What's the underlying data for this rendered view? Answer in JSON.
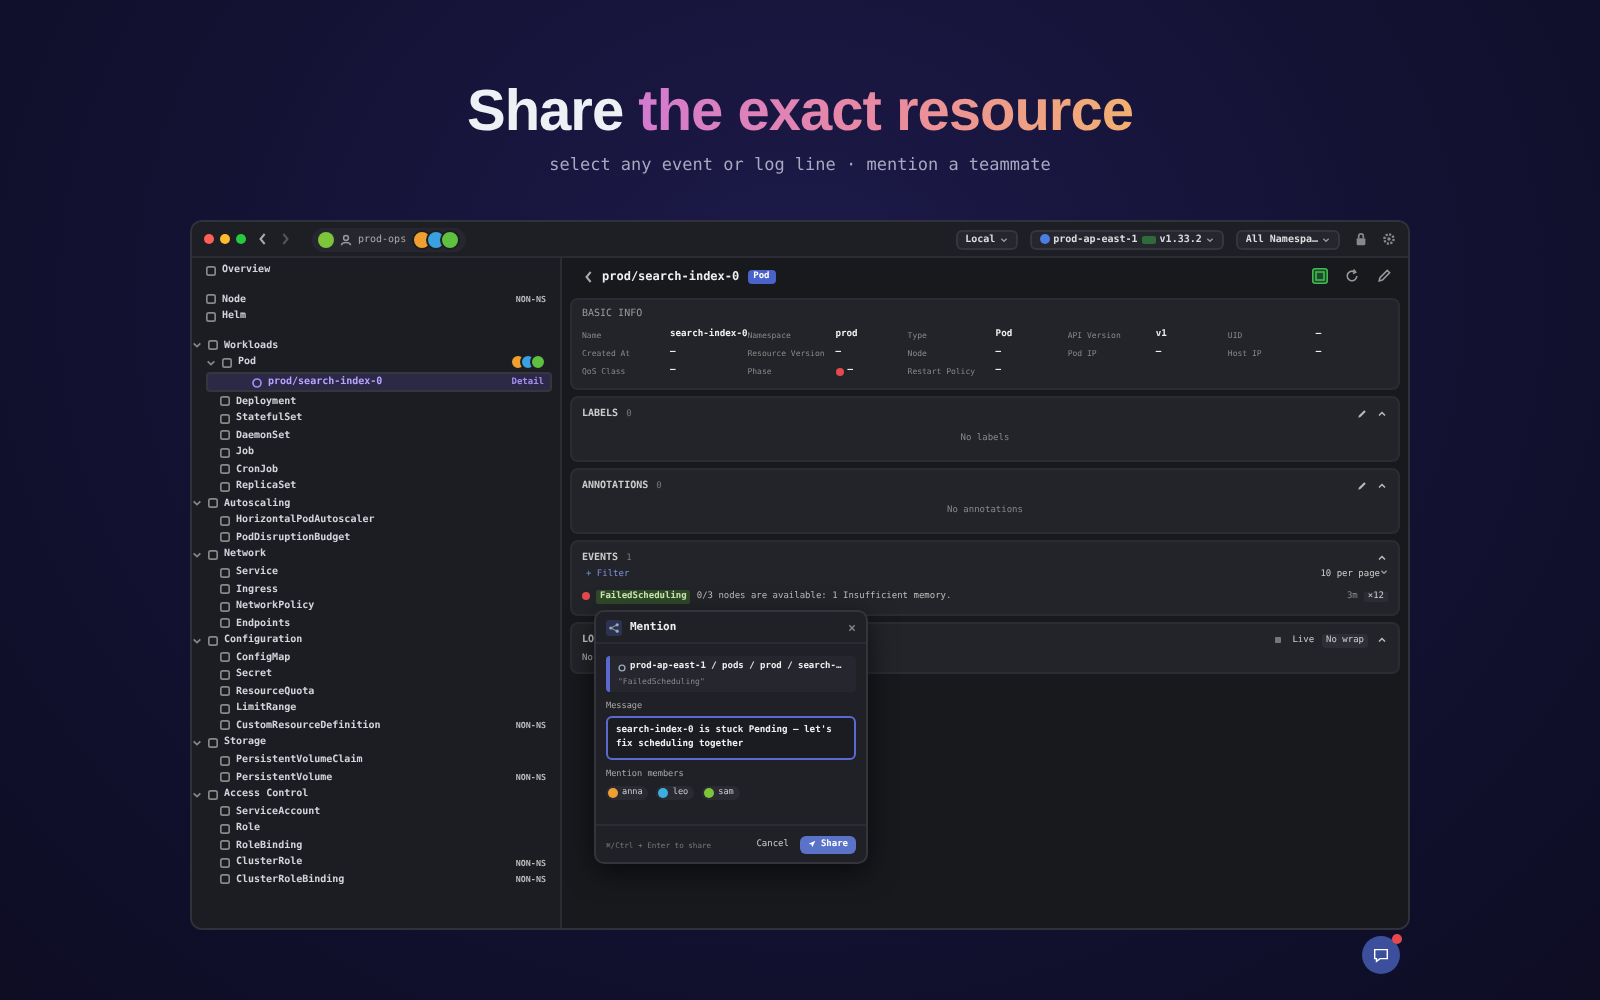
{
  "hero": {
    "title_plain": "Share",
    "title_gradient": "the exact resource",
    "subtitle": "select any event or log line · mention a teammate"
  },
  "topbar": {
    "workspace": "prod-ops",
    "avatars": [
      {
        "color": "#f0a030"
      },
      {
        "color": "#3aa0e0"
      },
      {
        "color": "#60c040"
      }
    ],
    "cluster": "Local",
    "context": "prod-ap-east-1",
    "version": "v1.33.2",
    "namespace": "All Namespa…"
  },
  "sidebar": {
    "items": [
      {
        "label": "Overview",
        "selected": false
      },
      {
        "label": "Node",
        "badge": "NON-NS",
        "selected": false
      },
      {
        "label": "Helm",
        "selected": false
      },
      {
        "label": "Workloads",
        "expanded": true,
        "selected": false,
        "children": [
          {
            "label": "Pod",
            "expanded": true,
            "selected": false,
            "avatars": [
              {
                "color": "#f0a030"
              },
              {
                "color": "#3aa0e0"
              },
              {
                "color": "#60c040"
              }
            ],
            "children": [
              {
                "label": "prod/search-index-0",
                "note": "Detail",
                "selected": true
              }
            ]
          },
          {
            "label": "Deployment",
            "selected": false
          },
          {
            "label": "StatefulSet",
            "selected": false
          },
          {
            "label": "DaemonSet",
            "selected": false
          },
          {
            "label": "Job",
            "selected": false
          },
          {
            "label": "CronJob",
            "selected": false
          },
          {
            "label": "ReplicaSet",
            "selected": false
          }
        ]
      },
      {
        "label": "Autoscaling",
        "expanded": true,
        "selected": false,
        "children": [
          {
            "label": "HorizontalPodAutoscaler",
            "selected": false
          },
          {
            "label": "PodDisruptionBudget",
            "selected": false
          }
        ]
      },
      {
        "label": "Network",
        "expanded": true,
        "selected": false,
        "children": [
          {
            "label": "Service",
            "selected": false
          },
          {
            "label": "Ingress",
            "selected": false
          },
          {
            "label": "NetworkPolicy",
            "selected": false
          },
          {
            "label": "Endpoints",
            "selected": false
          }
        ]
      },
      {
        "label": "Configuration",
        "expanded": true,
        "selected": false,
        "children": [
          {
            "label": "ConfigMap",
            "selected": false
          },
          {
            "label": "Secret",
            "selected": false
          },
          {
            "label": "ResourceQuota",
            "selected": false
          },
          {
            "label": "LimitRange",
            "selected": false
          },
          {
            "label": "CustomResourceDefinition",
            "badge": "NON-NS",
            "selected": false
          }
        ]
      },
      {
        "label": "Storage",
        "expanded": true,
        "selected": false,
        "children": [
          {
            "label": "PersistentVolumeClaim",
            "selected": false
          },
          {
            "label": "PersistentVolume",
            "badge": "NON-NS",
            "selected": false
          }
        ]
      },
      {
        "label": "Access Control",
        "expanded": true,
        "selected": false,
        "children": [
          {
            "label": "ServiceAccount",
            "selected": false
          },
          {
            "label": "Role",
            "selected": false
          },
          {
            "label": "RoleBinding",
            "selected": false
          },
          {
            "label": "ClusterRole",
            "badge": "NON-NS",
            "selected": false
          },
          {
            "label": "ClusterRoleBinding",
            "badge": "NON-NS",
            "selected": false
          }
        ]
      }
    ]
  },
  "detail": {
    "title": "prod/search-index-0",
    "kind_badge": "Pod",
    "basic_info": {
      "heading": "BASIC INFO",
      "fields": [
        {
          "label": "Name",
          "value": "search-index-0"
        },
        {
          "label": "Namespace",
          "value": "prod"
        },
        {
          "label": "Type",
          "value": "Pod"
        },
        {
          "label": "API Version",
          "value": "v1"
        },
        {
          "label": "UID",
          "value": "—"
        },
        {
          "label": "Created At",
          "value": "—"
        },
        {
          "label": "Resource Version",
          "value": "—"
        },
        {
          "label": "Node",
          "value": "—"
        },
        {
          "label": "Pod IP",
          "value": "—"
        },
        {
          "label": "Host IP",
          "value": "—"
        },
        {
          "label": "QoS Class",
          "value": "—"
        },
        {
          "label": "Phase",
          "value": "—",
          "color": "#e5484d"
        },
        {
          "label": "Restart Policy",
          "value": "—"
        }
      ]
    },
    "labels": {
      "heading": "LABELS",
      "count": "0",
      "empty": "No labels"
    },
    "annotations": {
      "heading": "ANNOTATIONS",
      "count": "0",
      "empty": "No annotations"
    },
    "events": {
      "heading": "EVENTS",
      "count": "1",
      "filter": "+ Filter",
      "page_size": "10 per page",
      "rows": [
        {
          "reason": "FailedScheduling",
          "message": "0/3 nodes are available: 1 Insufficient memory.",
          "age": "3m",
          "count": "×12",
          "color": "#e5484d"
        }
      ]
    },
    "logs": {
      "heading": "LO",
      "line": "No",
      "live": "Live",
      "wrap": "No wrap"
    }
  },
  "mention": {
    "title": "Mention",
    "context_path": "prod-ap-east-1 / pods / prod / search-…",
    "context_quote": "\"FailedScheduling\"",
    "message_label": "Message",
    "message": "search-index-0 is stuck Pending — let's fix scheduling together",
    "members_label": "Mention members",
    "members": [
      {
        "name": "anna",
        "color": "#f0a030"
      },
      {
        "name": "leo",
        "color": "#3ab0e0"
      },
      {
        "name": "sam",
        "color": "#7cc43a"
      }
    ],
    "hint": "⌘/Ctrl + Enter to share",
    "cancel": "Cancel",
    "share": "Share"
  }
}
